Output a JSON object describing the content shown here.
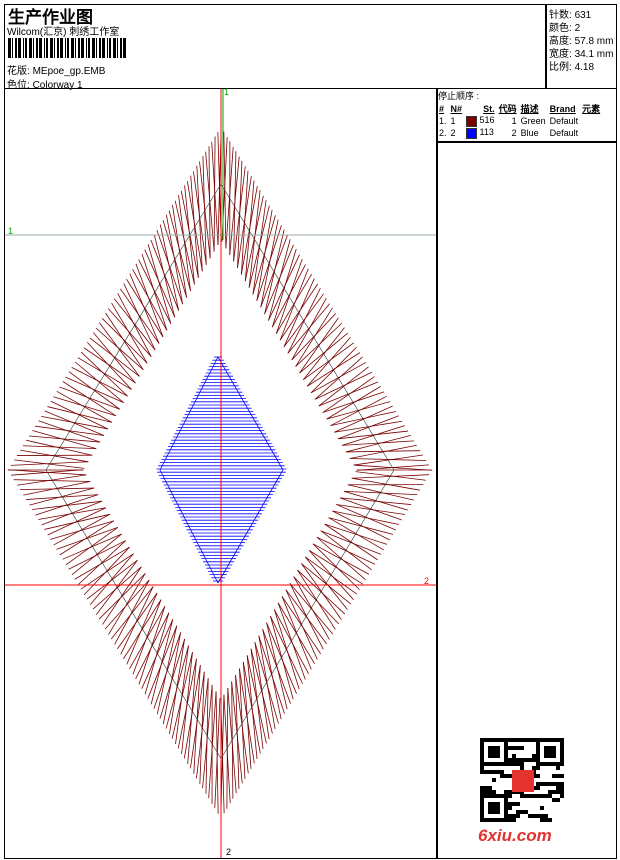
{
  "header": {
    "title": "生产作业图",
    "company": "Wilcom(汇京) 刺绣工作室",
    "design_label": "花版:",
    "design": "MEpoe_gp.EMB",
    "colorway_label": "色位:",
    "colorway": "Colorway 1"
  },
  "stats": [
    {
      "label": "针数:",
      "value": "631"
    },
    {
      "label": "颜色:",
      "value": "2"
    },
    {
      "label": "高度:",
      "value": "57.8 mm"
    },
    {
      "label": "宽度:",
      "value": "34.1 mm"
    },
    {
      "label": "比例:",
      "value": "4.18"
    }
  ],
  "stop_sequence": {
    "title": "停止顺序 :",
    "columns": [
      "#",
      "N#",
      "St.",
      "代码",
      "描述",
      "Brand",
      "元素"
    ],
    "rows": [
      {
        "idx": "1.",
        "n": "1",
        "color": "#7a0000",
        "st": "516",
        "code": "1",
        "desc": "Green",
        "brand": "Default"
      },
      {
        "idx": "2.",
        "n": "2",
        "color": "#0000ff",
        "st": "113",
        "code": "2",
        "desc": "Blue",
        "brand": "Default"
      }
    ]
  },
  "guides": {
    "green_label_top": "1",
    "green_label_left": "1",
    "red_label_right": "2",
    "red_label_bottom": "2"
  },
  "watermark": "6xiu.com"
}
